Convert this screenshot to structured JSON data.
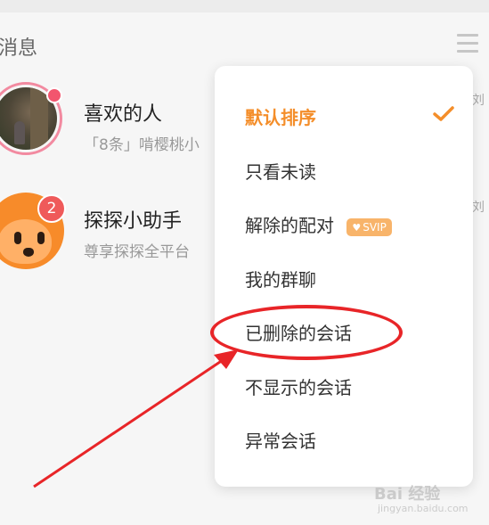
{
  "header": {
    "title": "消息"
  },
  "conversations": [
    {
      "name": "喜欢的人",
      "preview": "「8条」啃樱桃小",
      "side": "刘"
    },
    {
      "name": "探探小助手",
      "preview": "尊享探探全平台",
      "badge": "2",
      "side": "刘"
    }
  ],
  "dropdown": {
    "items": [
      {
        "label": "默认排序",
        "active": true
      },
      {
        "label": "只看未读"
      },
      {
        "label": "解除的配对",
        "tag": "SVIP"
      },
      {
        "label": "我的群聊"
      },
      {
        "label": "已删除的会话",
        "highlighted": true
      },
      {
        "label": "不显示的会话"
      },
      {
        "label": "异常会话"
      }
    ]
  },
  "watermark": {
    "text": "Bai 经验",
    "url": "jingyan.baidu.com"
  },
  "colors": {
    "accent": "#f48e2a",
    "annotation": "#e82528",
    "svip": "#f8b46a"
  },
  "icons": [
    "menu-icon",
    "checkmark-icon",
    "heart-icon"
  ]
}
